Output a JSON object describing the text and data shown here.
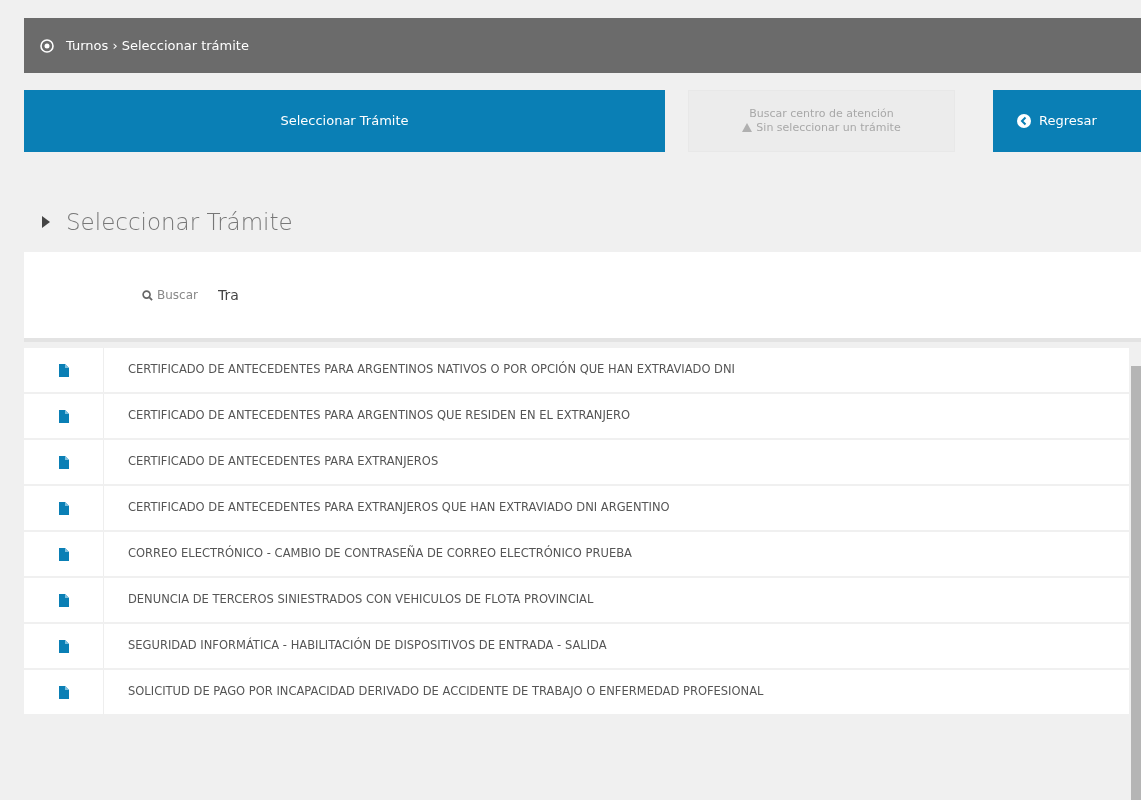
{
  "breadcrumb": "Turnos › Seleccionar trámite",
  "steps": [
    {
      "label": "Seleccionar Trámite",
      "disabled": false
    },
    {
      "label": "Buscar centro de atención",
      "sublabel": "Sin seleccionar un trámite",
      "disabled": true
    }
  ],
  "back_button": "Regresar",
  "section_title": "Seleccionar Trámite",
  "search": {
    "label": "Buscar",
    "value": "Tra"
  },
  "results": [
    {
      "label": "CERTIFICADO DE ANTECEDENTES PARA ARGENTINOS NATIVOS O POR OPCIÓN QUE HAN EXTRAVIADO DNI"
    },
    {
      "label": "CERTIFICADO DE ANTECEDENTES PARA ARGENTINOS QUE RESIDEN EN EL EXTRANJERO"
    },
    {
      "label": "CERTIFICADO DE ANTECEDENTES PARA EXTRANJEROS"
    },
    {
      "label": "CERTIFICADO DE ANTECEDENTES PARA EXTRANJEROS QUE HAN EXTRAVIADO DNI ARGENTINO"
    },
    {
      "label": "CORREO ELECTRÓNICO - CAMBIO DE CONTRASEÑA DE CORREO ELECTRÓNICO PRUEBA"
    },
    {
      "label": "DENUNCIA DE TERCEROS SINIESTRADOS CON VEHICULOS DE FLOTA PROVINCIAL"
    },
    {
      "label": "SEGURIDAD INFORMÁTICA - HABILITACIÓN DE DISPOSITIVOS DE ENTRADA - SALIDA"
    },
    {
      "label": "SOLICITUD DE PAGO POR INCAPACIDAD DERIVADO DE ACCIDENTE DE TRABAJO O ENFERMEDAD PROFESIONAL"
    }
  ]
}
